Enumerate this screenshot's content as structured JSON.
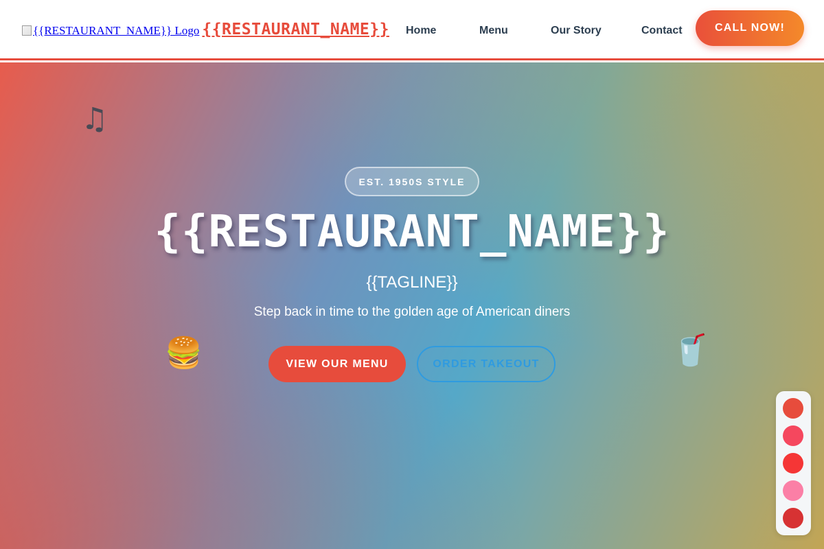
{
  "header": {
    "logo_alt": "{{RESTAURANT_NAME}} Logo",
    "brand_name": "{{RESTAURANT_NAME}}",
    "nav": {
      "home": "Home",
      "menu": "Menu",
      "story": "Our Story",
      "contact": "Contact"
    },
    "cta_label": "CALL NOW!"
  },
  "hero": {
    "badge": "EST. 1950S STYLE",
    "title": "{{RESTAURANT_NAME}}",
    "tagline": "{{TAGLINE}}",
    "subtitle": "Step back in time to the golden age of American diners",
    "primary_button": "VIEW OUR MENU",
    "secondary_button": "ORDER TAKEOUT",
    "icons": {
      "note": "♫",
      "burger": "🍔",
      "cup": "🥤"
    }
  },
  "theme_swatches": [
    {
      "name": "swatch-1",
      "color": "#e74c3c"
    },
    {
      "name": "swatch-2",
      "color": "#f5475e"
    },
    {
      "name": "swatch-3",
      "color": "#f53636"
    },
    {
      "name": "swatch-4",
      "color": "#fb7fa6"
    },
    {
      "name": "swatch-5",
      "color": "#d73233"
    }
  ],
  "colors": {
    "accent": "#e74c3c",
    "nav_text": "#2c3e50",
    "secondary_button": "#2f9be0"
  }
}
